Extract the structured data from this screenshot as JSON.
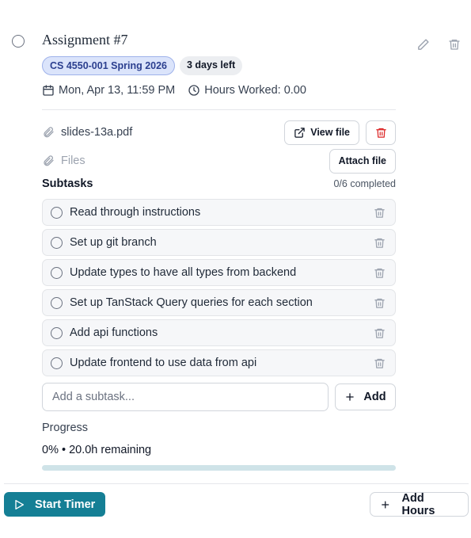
{
  "task": {
    "title": "Assignment #7",
    "course_badge": "CS 4550-001 Spring 2026",
    "due_badge": "3 days left",
    "due_date": "Mon, Apr 13, 11:59 PM",
    "hours_worked": "Hours Worked: 0.00"
  },
  "attachments": {
    "file_name": "slides-13a.pdf",
    "view_label": "View file",
    "files_label": "Files",
    "attach_label": "Attach file"
  },
  "subtasks": {
    "heading": "Subtasks",
    "completed": "0/6 completed",
    "items": [
      {
        "label": "Read through instructions"
      },
      {
        "label": "Set up git branch"
      },
      {
        "label": "Update types to have all types from backend"
      },
      {
        "label": "Set up TanStack Query queries for each section"
      },
      {
        "label": "Add api functions"
      },
      {
        "label": "Update frontend to use data from api"
      }
    ],
    "placeholder": "Add a subtask...",
    "add_label": "Add"
  },
  "progress": {
    "label": "Progress",
    "summary": "0% • 20.0h remaining",
    "percent": 0
  },
  "footer": {
    "start_label": "Start Timer",
    "add_hours_label": "Add Hours"
  },
  "colors": {
    "accent": "#157f95",
    "danger": "#dc2626",
    "badge_bg": "#dbe4fb"
  },
  "icons": [
    "circle-icon",
    "pencil-icon",
    "trash-icon",
    "calendar-icon",
    "clock-icon",
    "paperclip-icon",
    "external-link-icon",
    "plus-icon",
    "play-icon"
  ]
}
